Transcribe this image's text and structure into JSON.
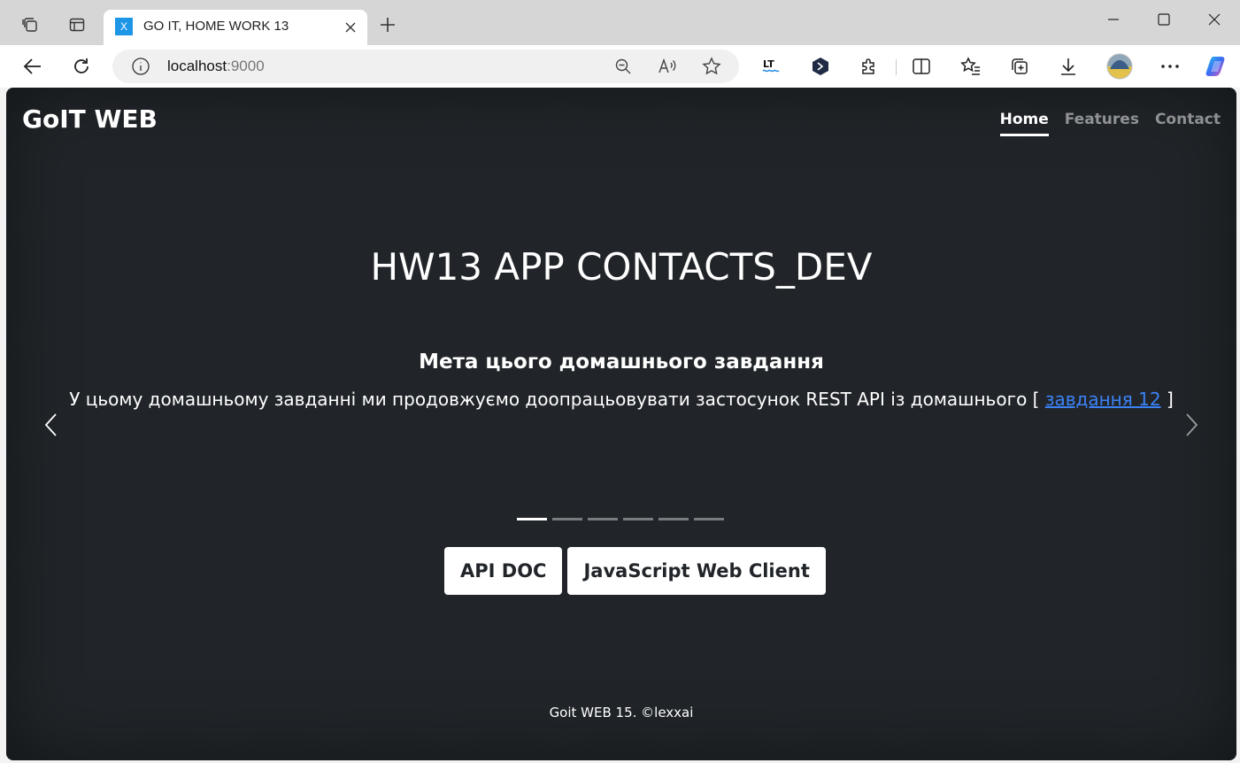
{
  "browser": {
    "tab_title": "GO IT, HOME WORK 13",
    "tab_favicon_letter": "X",
    "address_host": "localhost",
    "address_port": ":9000"
  },
  "page": {
    "brand": "GoIT WEB",
    "nav": [
      {
        "label": "Home",
        "active": true
      },
      {
        "label": "Features",
        "active": false
      },
      {
        "label": "Contact",
        "active": false
      }
    ],
    "hero_title": "HW13 APP CONTACTS_DEV",
    "slide": {
      "heading": "Мета цього домашнього завдання",
      "text_before": "У цьому домашньому завданні ми продовжуємо доопрацьовувати застосунок REST API із домашнього [ ",
      "link_text": "завдання 12",
      "text_after": " ]"
    },
    "indicators_count": 6,
    "active_indicator": 1,
    "buttons": {
      "api_doc": "API DOC",
      "js_client": "JavaScript Web Client"
    },
    "footer": "Goit WEB 15. ©lexxai"
  },
  "colors": {
    "page_bg": "#212529",
    "link": "#3b82f6",
    "tab_favicon": "#1e96e8"
  }
}
